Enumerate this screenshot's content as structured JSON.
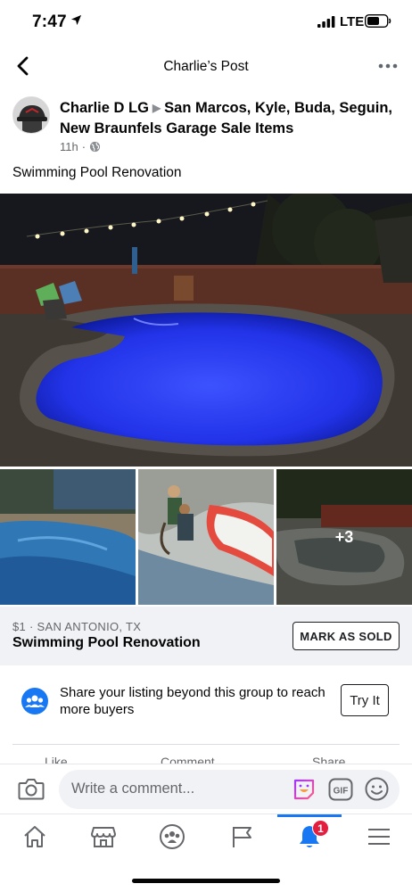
{
  "status_bar": {
    "time": "7:47",
    "network": "LTE"
  },
  "nav": {
    "title": "Charlie’s Post"
  },
  "post": {
    "author": "Charlie D LG",
    "group": "San Marcos, Kyle, Buda, Seguin, New Braunfels Garage Sale Items",
    "time": "11h",
    "separator": "·",
    "text": "Swimming Pool Renovation",
    "more_photos": "+3"
  },
  "listing": {
    "price_location": "$1 · SAN ANTONIO, TX",
    "title": "Swimming Pool Renovation",
    "mark_sold_label": "MARK AS SOLD"
  },
  "share_prompt": {
    "text": "Share your listing beyond this group to reach more buyers",
    "button_label": "Try It"
  },
  "actions": {
    "like": "Like",
    "comment": "Comment",
    "share": "Share"
  },
  "comment_bar": {
    "placeholder": "Write a comment...",
    "gif_label": "GIF"
  },
  "tabbar": {
    "notifications_badge": "1"
  },
  "colors": {
    "accent": "#1877f2",
    "badge": "#e41e3f",
    "pool_light": "#2a3cff"
  },
  "icons": [
    "location-arrow-icon",
    "signal-icon",
    "battery-icon",
    "back-chevron-icon",
    "more-icon",
    "globe-icon",
    "group-icon",
    "camera-icon",
    "sticker-icon",
    "gif-icon",
    "emoji-icon",
    "home-icon",
    "marketplace-icon",
    "groups-icon",
    "pages-flag-icon",
    "notifications-bell-icon",
    "menu-icon"
  ]
}
